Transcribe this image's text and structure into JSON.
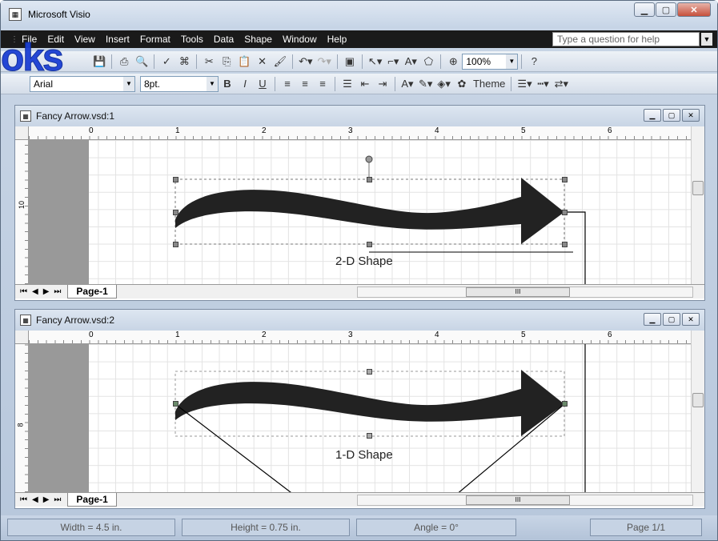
{
  "app": {
    "title": "Microsoft Visio",
    "title_icon": "visio-app-icon"
  },
  "menubar": {
    "items": [
      "File",
      "Edit",
      "View",
      "Insert",
      "Format",
      "Tools",
      "Data",
      "Shape",
      "Window",
      "Help"
    ],
    "help_placeholder": "Type a question for help"
  },
  "toolbar1": {
    "zoom": "100%"
  },
  "toolbar2": {
    "font": "Arial",
    "font_size": "8pt.",
    "theme_label": "Theme"
  },
  "watermark_text": "oks",
  "windows": [
    {
      "title": "Fancy Arrow.vsd:1",
      "ruler_h": [
        "0",
        "1",
        "2",
        "3",
        "4",
        "5",
        "6"
      ],
      "ruler_v": "10",
      "shape_label": "2-D Shape",
      "page_tab": "Page-1"
    },
    {
      "title": "Fancy Arrow.vsd:2",
      "ruler_h": [
        "0",
        "1",
        "2",
        "3",
        "4",
        "5",
        "6"
      ],
      "ruler_v": "8",
      "shape_label": "1-D Shape",
      "page_tab": "Page-1"
    }
  ],
  "status": {
    "width": "Width = 4.5 in.",
    "height": "Height = 0.75 in.",
    "angle": "Angle = 0°",
    "page": "Page 1/1"
  },
  "colors": {
    "arrow": "#222222",
    "menubar": "#1a1a1a",
    "watermark": "#1b3fd4"
  }
}
